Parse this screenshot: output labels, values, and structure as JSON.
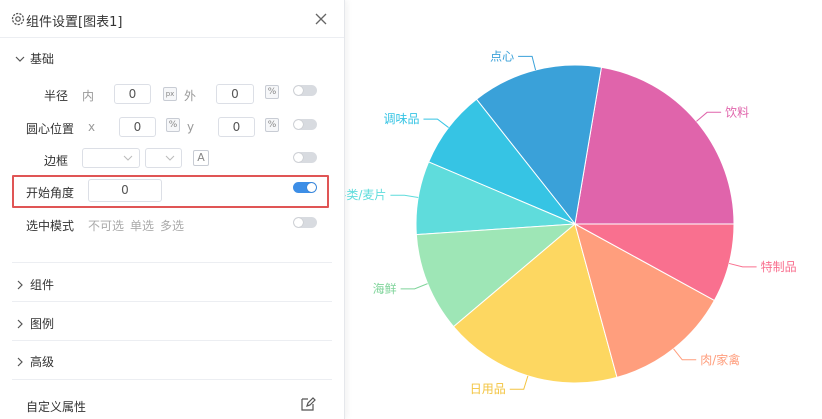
{
  "panel": {
    "title": "组件设置[图表1]",
    "basic_section": "基础",
    "radius": {
      "label": "半径",
      "inner_label": "内",
      "inner_value": "0",
      "outer_label": "外",
      "outer_value": "0",
      "unit_px": "px",
      "unit_pct": "%"
    },
    "center": {
      "label": "圆心位置",
      "x_label": "x",
      "x_value": "0",
      "y_label": "y",
      "y_value": "0",
      "unit_pct": "%"
    },
    "border": {
      "label": "边框",
      "font_glyph": "A"
    },
    "start_angle": {
      "label": "开始角度",
      "value": "0"
    },
    "select_mode": {
      "label": "选中模式",
      "options": [
        "不可选",
        "单选",
        "多选"
      ]
    },
    "sections": [
      "组件",
      "图例",
      "高级"
    ],
    "custom_attr": "自定义属性",
    "toggles": {
      "radius": false,
      "center": false,
      "border": false,
      "start_angle": true,
      "select_mode": false
    }
  },
  "chart_data": {
    "type": "pie",
    "categories": [
      "饮料",
      "点心",
      "调味品",
      "谷类/麦片",
      "海鲜",
      "日用品",
      "肉/家禽",
      "特制品"
    ],
    "values": [
      21,
      12.5,
      7.5,
      7,
      9.5,
      17,
      12,
      7.5
    ],
    "colors": [
      "#e064ab",
      "#3aa1d9",
      "#36c4e4",
      "#5fdcdc",
      "#9ee6b6",
      "#fdd761",
      "#ff9e7d",
      "#f9708f"
    ],
    "label_colors": [
      "#e064ab",
      "#3aa1d9",
      "#36c4e4",
      "#5fdcdc",
      "#7fd49a",
      "#f3c440",
      "#ff9e7d",
      "#f9708f"
    ],
    "start_angle_deg": 0,
    "title": "",
    "legend": "none"
  }
}
